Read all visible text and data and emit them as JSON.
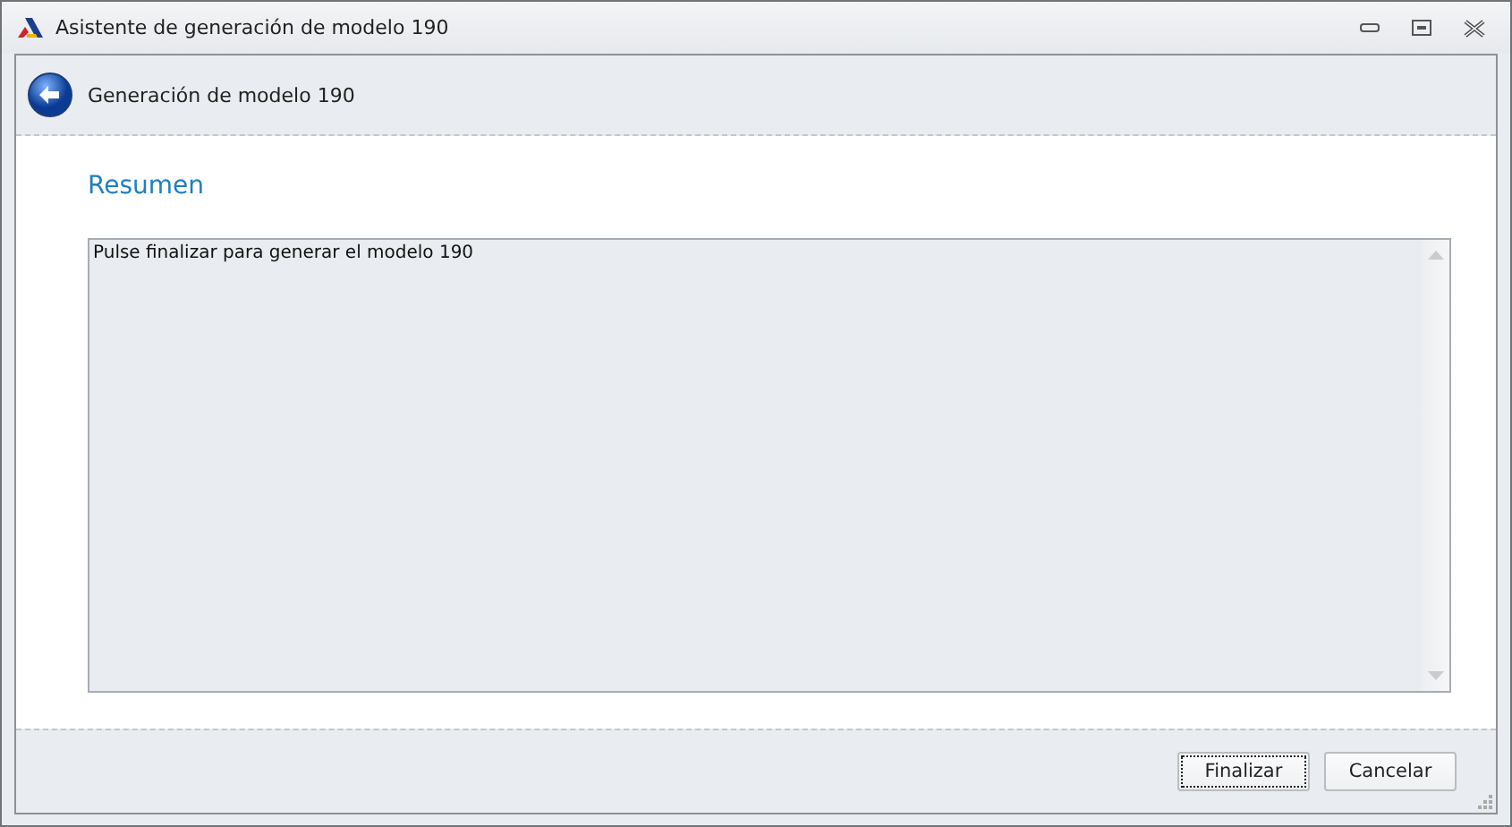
{
  "window": {
    "title": "Asistente de generación de modelo 190"
  },
  "header": {
    "title": "Generación de modelo 190"
  },
  "section_title": "Resumen",
  "summary": {
    "text": "Pulse finalizar para generar el modelo 190"
  },
  "buttons": [
    {
      "label": "Finalizar",
      "focused": true
    },
    {
      "label": "Cancelar",
      "focused": false
    }
  ]
}
